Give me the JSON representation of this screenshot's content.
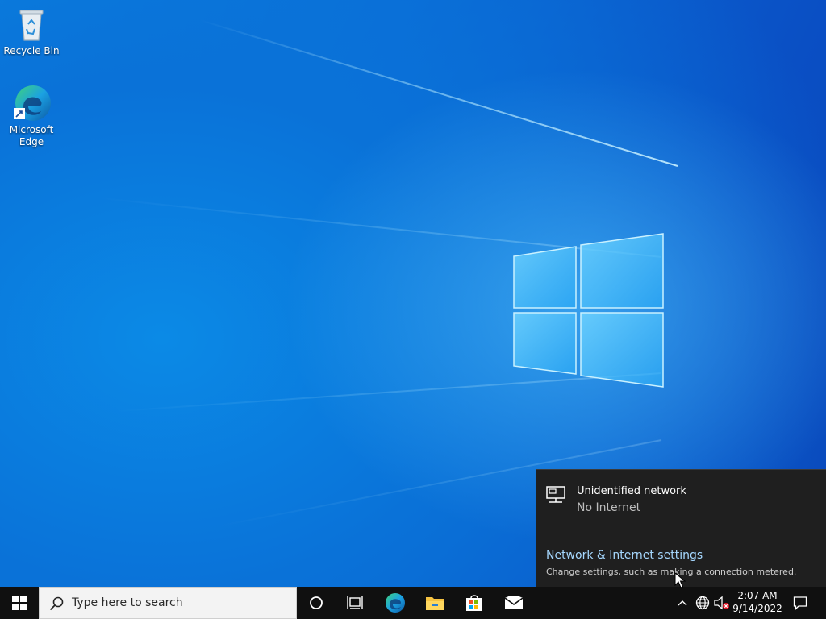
{
  "desktop": {
    "icons": [
      {
        "label": "Recycle Bin",
        "icon": "recycle-bin-icon"
      },
      {
        "label": "Microsoft\nEdge",
        "icon": "edge-icon"
      }
    ]
  },
  "network_flyout": {
    "network_name": "Unidentified network",
    "network_status": "No Internet",
    "settings_link": "Network & Internet settings",
    "settings_description": "Change settings, such as making a connection metered.",
    "icon": "wired-network-icon"
  },
  "taskbar": {
    "start_icon": "windows-start-icon",
    "search_placeholder": "Type here to search",
    "pinned": [
      {
        "name": "Cortana",
        "icon": "cortana-circle-icon"
      },
      {
        "name": "Task View",
        "icon": "task-view-icon"
      },
      {
        "name": "Microsoft Edge",
        "icon": "edge-icon"
      },
      {
        "name": "File Explorer",
        "icon": "folder-icon"
      },
      {
        "name": "Microsoft Store",
        "icon": "store-icon"
      },
      {
        "name": "Mail",
        "icon": "mail-icon"
      }
    ],
    "tray": {
      "icons": [
        "chevron-up-icon",
        "network-globe-icon",
        "volume-muted-icon"
      ],
      "time": "2:07 AM",
      "date": "9/14/2022",
      "notification_icon": "action-center-icon"
    }
  },
  "colors": {
    "taskbar": "#101010",
    "flyout_bg": "#1f1f1f",
    "link": "#a6d8ff",
    "accent": "#0078d7"
  }
}
